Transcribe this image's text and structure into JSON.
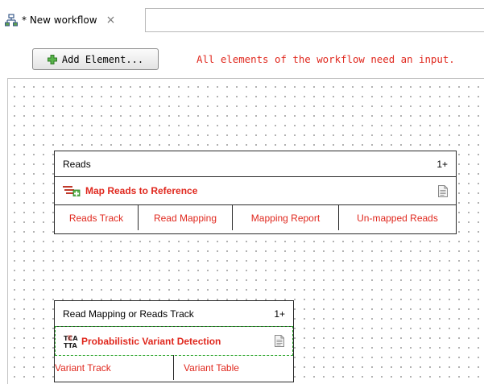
{
  "tab": {
    "title": "* New workflow",
    "close_glyph": "×",
    "icon": "workflow-icon"
  },
  "toolbar": {
    "add_label": "Add Element...",
    "add_icon": "plus-icon",
    "warning": "All elements of the workflow need an input."
  },
  "colors": {
    "error_red": "#e0281e",
    "selection_green": "#2aa52a",
    "border": "#2a2a2a"
  },
  "nodes": [
    {
      "input_label": "Reads",
      "input_count": "1+",
      "title": "Map Reads to Reference",
      "icon": "map-reads-icon",
      "outputs": [
        "Reads Track",
        "Read Mapping",
        "Mapping Report",
        "Un-mapped Reads"
      ]
    },
    {
      "input_label": "Read Mapping or Reads Track",
      "input_count": "1+",
      "title": "Probabilistic Variant Detection",
      "icon": "variant-detection-icon",
      "outputs": [
        "Variant Track",
        "Variant Table"
      ]
    }
  ]
}
